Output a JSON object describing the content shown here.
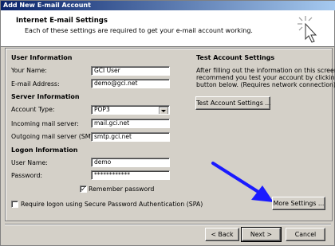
{
  "window": {
    "title": "Add New E-mail Account"
  },
  "header": {
    "title": "Internet E-mail Settings",
    "subtitle": "Each of these settings are required to get your e-mail account working."
  },
  "user_info": {
    "heading": "User Information",
    "name_label": "Your Name:",
    "name_value": "GCI User",
    "email_label": "E-mail Address:",
    "email_value": "demo@gci.net"
  },
  "server_info": {
    "heading": "Server Information",
    "account_type_label": "Account Type:",
    "account_type_value": "POP3",
    "incoming_label": "Incoming mail server:",
    "incoming_value": "mail.gci.net",
    "outgoing_label": "Outgoing mail server (SMTP):",
    "outgoing_value": "smtp.gci.net"
  },
  "logon_info": {
    "heading": "Logon Information",
    "username_label": "User Name:",
    "username_value": "demo",
    "password_label": "Password:",
    "password_value": "************",
    "remember_label": "Remember password",
    "remember_checked": true,
    "spa_label": "Require logon using Secure Password Authentication (SPA)",
    "spa_checked": false
  },
  "test_settings": {
    "heading": "Test Account Settings",
    "line1": "After filling out the information on this screen, we",
    "line2": "recommend you test your account by clicking the",
    "line3": "button below. (Requires network connection)",
    "test_button": "Test Account Settings ..."
  },
  "buttons": {
    "more_settings": "More Settings ...",
    "back": "< Back",
    "next": "Next >",
    "cancel": "Cancel"
  },
  "colors": {
    "annotation_arrow": "#1a1aff"
  },
  "icons": {
    "header_icon": "cursor-click-icon",
    "annotation": "arrow-annotation-icon"
  }
}
